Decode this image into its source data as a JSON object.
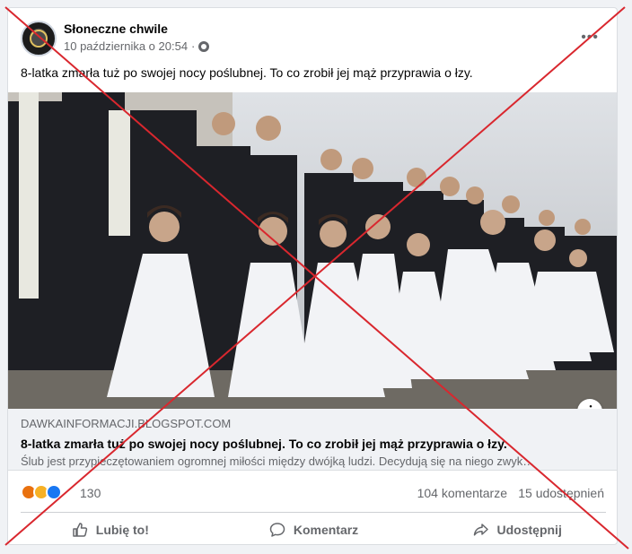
{
  "post": {
    "page_name": "Słoneczne chwile",
    "date": "10 października o 20:54",
    "separator": "·",
    "text": "8-latka zmarła tuż po swojej nocy poślubnej. To co zrobił jej mąż przyprawia o łzy."
  },
  "link_preview": {
    "domain": "DAWKAINFORMACJI.BLOGSPOT.COM",
    "title": "8-latka zmarła tuż po swojej nocy poślubnej. To co zrobił jej mąż przyprawia o łzy.",
    "description": "Ślub jest przypieczętowaniem ogromnej miłości między dwójką ludzi. Decydują się na niego zwyk…"
  },
  "stats": {
    "reaction_count": "130",
    "comments": "104 komentarze",
    "shares": "15 udostępnień"
  },
  "actions": {
    "like": "Lubię to!",
    "comment": "Komentarz",
    "share": "Udostępnij"
  },
  "icons": {
    "more": "more-dots-icon",
    "visibility": "globe-icon",
    "info": "info-icon",
    "reactions": [
      "angry-reaction-icon",
      "sad-reaction-icon",
      "like-reaction-icon"
    ]
  },
  "colors": {
    "cross_red": "#d9272e",
    "like_blue": "#1877f2",
    "angry_orange": "#e9710f",
    "sad_yellow": "#f7b125"
  }
}
